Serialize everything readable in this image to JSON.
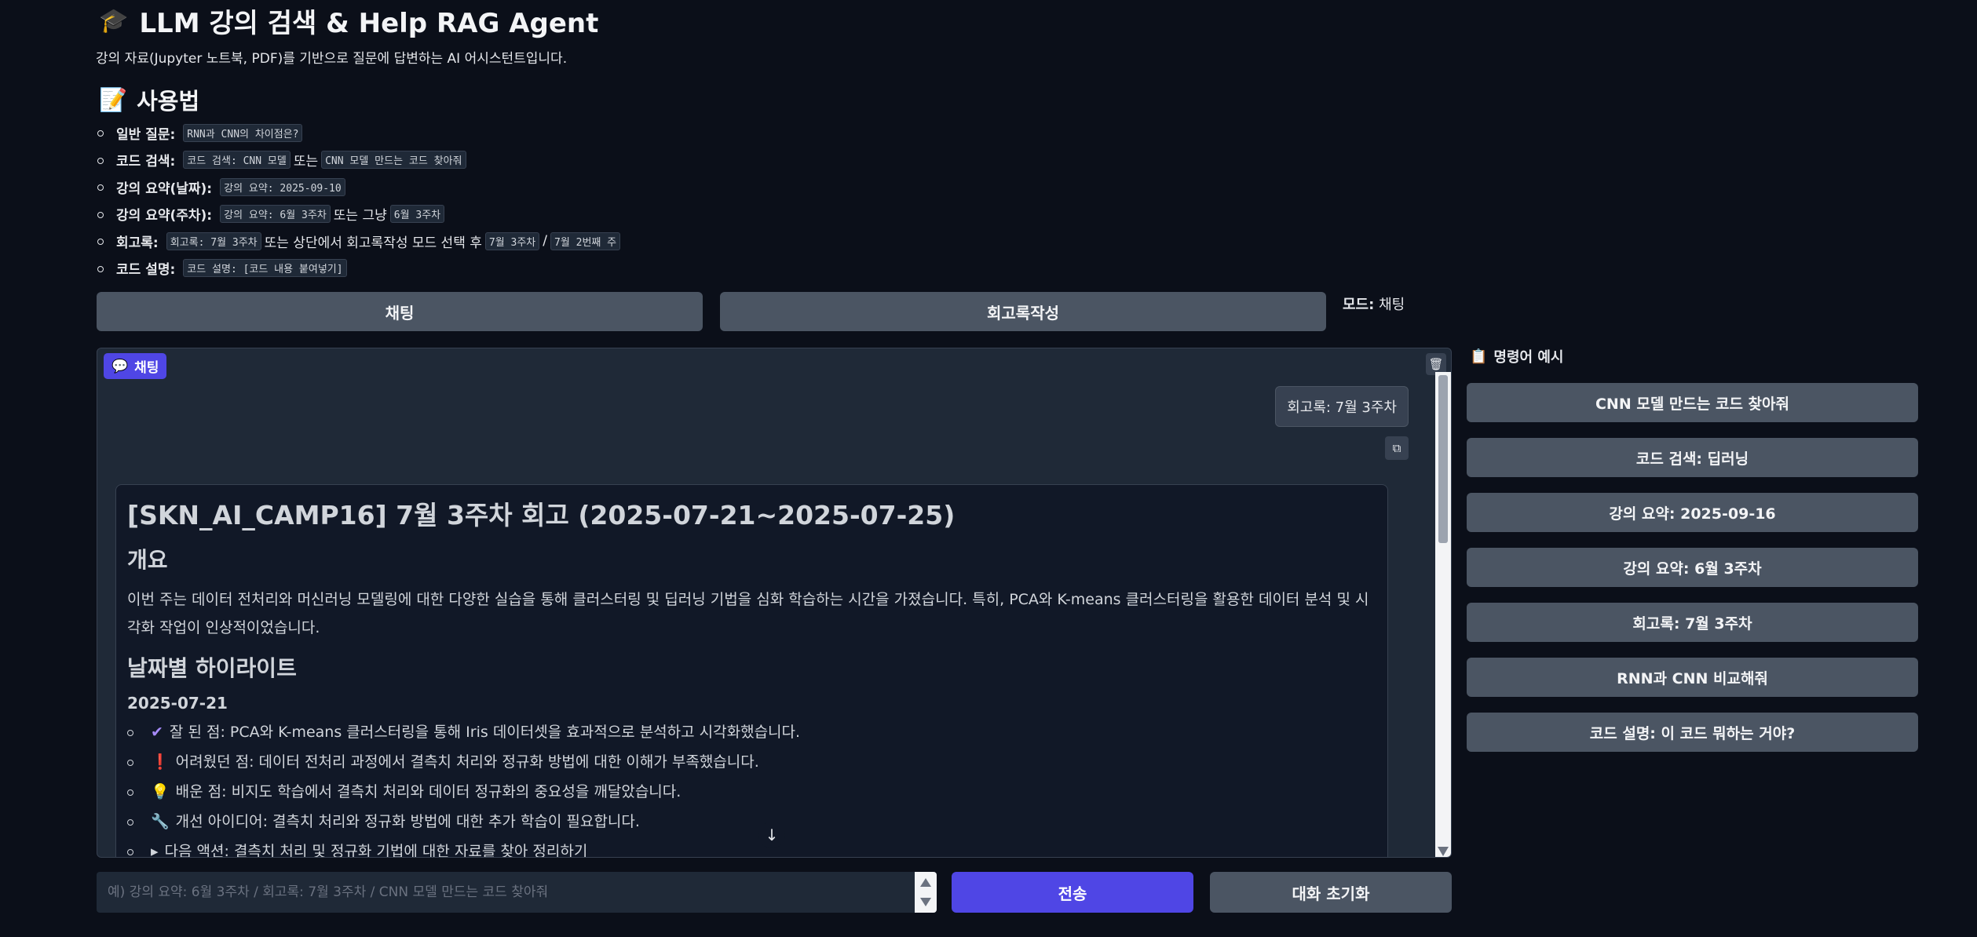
{
  "header": {
    "title": "LLM 강의 검색 & Help RAG Agent",
    "subtitle": "강의 자료(Jupyter 노트북, PDF)를 기반으로 질문에 답변하는 AI 어시스턴트입니다."
  },
  "usage": {
    "heading": "사용법",
    "items": [
      {
        "label": "일반 질문:",
        "parts": [
          "RNN과 CNN의 차이점은?"
        ],
        "seps": []
      },
      {
        "label": "코드 검색:",
        "parts": [
          "코드 검색: CNN 모델",
          "CNN 모델 만드는 코드 찾아줘"
        ],
        "seps": [
          "또는"
        ]
      },
      {
        "label": "강의 요약(날짜):",
        "parts": [
          "강의 요약: 2025-09-10"
        ],
        "seps": []
      },
      {
        "label": "강의 요약(주차):",
        "parts": [
          "강의 요약: 6월 3주차",
          "6월 3주차"
        ],
        "seps": [
          "또는 그냥"
        ]
      },
      {
        "label": "회고록:",
        "parts": [
          "회고록: 7월 3주차",
          "7월 3주차",
          "7월 2번째 주"
        ],
        "seps": [
          "또는 상단에서 회고록작성 모드 선택 후",
          "/"
        ]
      },
      {
        "label": "코드 설명:",
        "parts": [
          "코드 설명: [코드 내용 붙여넣기]"
        ],
        "seps": []
      }
    ]
  },
  "modes": {
    "chat_label": "채팅",
    "retro_label": "회고록작성",
    "current_prefix": "모드:",
    "current_value": "채팅"
  },
  "chat": {
    "tag": "채팅",
    "user_message": "회고록: 7월 3주차",
    "bot": {
      "h1": "[SKN_AI_CAMP16] 7월 3주차 회고 (2025-07-21~2025-07-25)",
      "overview_h": "개요",
      "overview_p": "이번 주는 데이터 전처리와 머신러닝 모델링에 대한 다양한 실습을 통해 클러스터링 및 딥러닝 기법을 심화 학습하는 시간을 가졌습니다. 특히, PCA와 K-means 클러스터링을 활용한 데이터 분석 및 시각화 작업이 인상적이었습니다.",
      "highlight_h": "날짜별 하이라이트",
      "date": "2025-07-21",
      "items": [
        {
          "emoji": "✔",
          "text": "잘 된 점: PCA와 K-means 클러스터링을 통해 Iris 데이터셋을 효과적으로 분석하고 시각화했습니다."
        },
        {
          "emoji": "❗",
          "text": "어려웠던 점: 데이터 전처리 과정에서 결측치 처리와 정규화 방법에 대한 이해가 부족했습니다."
        },
        {
          "emoji": "💡",
          "text": "배운 점: 비지도 학습에서 결측치 처리와 데이터 정규화의 중요성을 깨달았습니다."
        },
        {
          "emoji": "🔧",
          "text": "개선 아이디어: 결측치 처리와 정규화 방법에 대한 추가 학습이 필요합니다."
        },
        {
          "emoji": "▸",
          "text": "다음 액션: 결측치 처리 및 정규화 기법에 대한 자료를 찾아 정리하기"
        }
      ]
    }
  },
  "examples": {
    "heading": "명령어 예시",
    "buttons": [
      "CNN 모델 만드는 코드 찾아줘",
      "코드 검색: 딥러닝",
      "강의 요약: 2025-09-16",
      "강의 요약: 6월 3주차",
      "회고록: 7월 3주차",
      "RNN과 CNN 비교해줘",
      "코드 설명: 이 코드 뭐하는 거야?"
    ]
  },
  "input": {
    "value": "",
    "placeholder": "예) 강의 요약: 6월 3주차 / 회고록: 7월 3주차 / CNN 모델 만드는 코드 찾아줘"
  },
  "actions": {
    "send_label": "전송",
    "reset_label": "대화 초기화"
  },
  "colors": {
    "background": "#0b0f19",
    "primary": "#4f46e5",
    "secondary": "#4b5563"
  }
}
